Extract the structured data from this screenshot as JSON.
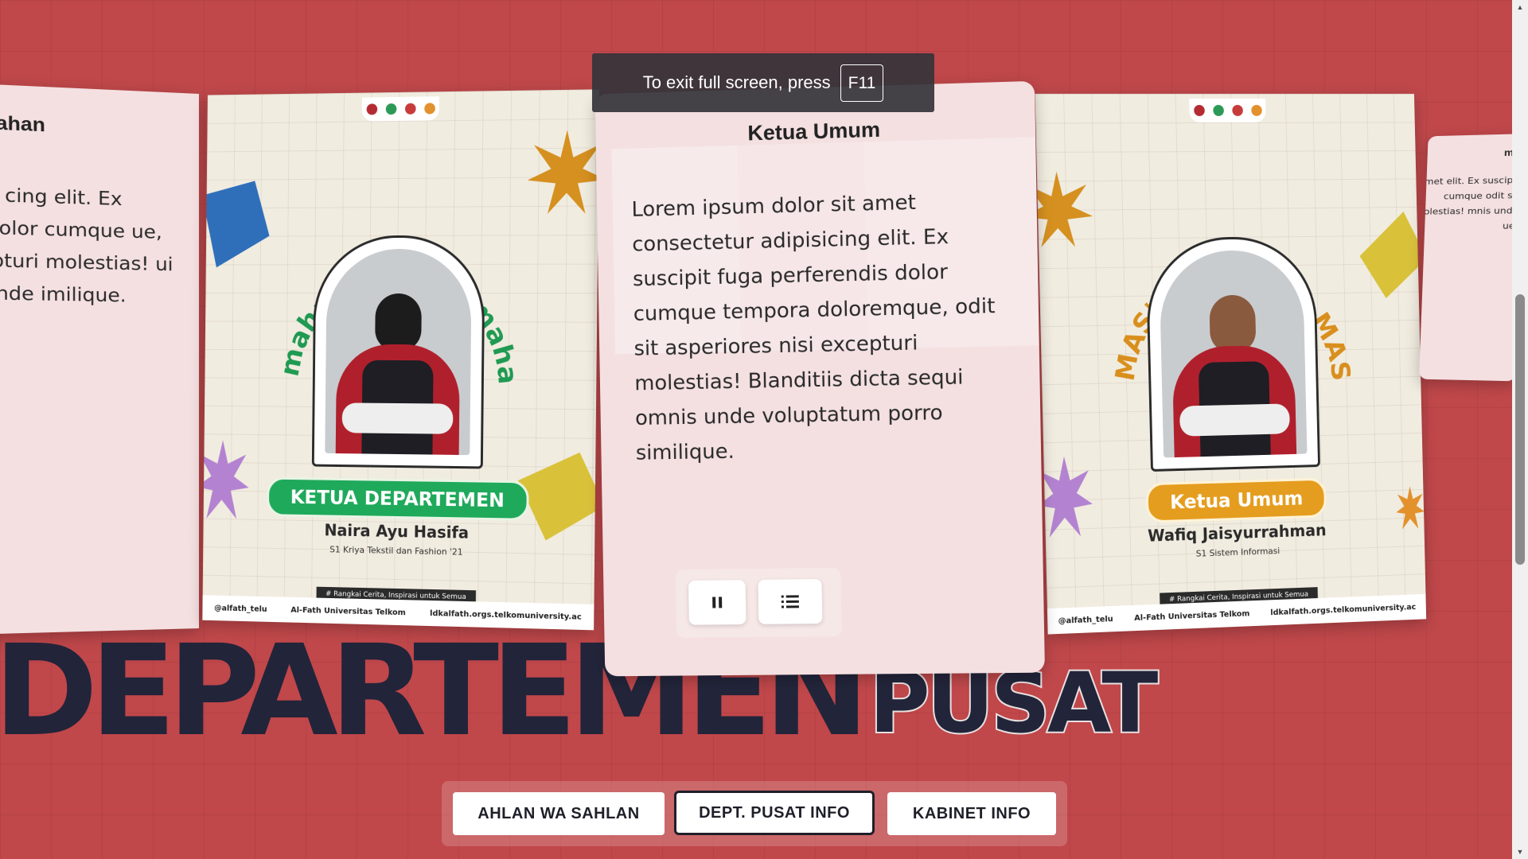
{
  "colors": {
    "background": "#c0474a",
    "heading": "#22243a",
    "card_pink": "#f4e0e1",
    "green_pill": "#1fa95b",
    "orange_pill": "#e59d1f"
  },
  "slides": {
    "far_left": {
      "title": "mahan",
      "text": "sit amet cing elit. Ex suscipit olor cumque ue, odit sit pturi molestias! ui omnis unde imilique."
    },
    "poster_left": {
      "arc_text": "mahan Kemuslimahan Kemusl",
      "role": "KETUA DEPARTEMEN",
      "name": "Naira Ayu Hasifa",
      "major": "S1 Kriya Tekstil dan Fashion '21",
      "tagline": "# Rangkai Cerita, Inspirasi untuk Semua",
      "footer": [
        "@alfath_telu",
        "Al-Fath Universitas Telkom",
        "ldkalfath.orgs.telkomuniversity.ac"
      ]
    },
    "center": {
      "title": "Ketua Umum",
      "text": "Lorem ipsum dolor sit amet consectetur adipisicing elit. Ex suscipit fuga perferendis dolor cumque tempora doloremque, odit sit asperiores nisi excepturi molestias! Blanditiis dicta sequi omnis unde voluptatum porro similique."
    },
    "poster_right": {
      "arc_text": "MAS'UL MAS'UL MAS'UL MASUL",
      "role": "Ketua Umum",
      "name": "Wafiq Jaisyurrahman",
      "major": "S1 Sistem Informasi",
      "tagline": "# Rangkai Cerita, Inspirasi untuk Semua",
      "footer": [
        "@alfath_telu",
        "Al-Fath Universitas Telkom",
        "ldkalfath.orgs.telkomuniversity.ac"
      ]
    },
    "far_right": {
      "title": "mum",
      "text": "amet elit. Ex suscipit cumque odit sit molestias! mnis unde ue."
    }
  },
  "controls": {
    "pause_icon": "pause-icon",
    "list_icon": "list-icon"
  },
  "heading": {
    "main": "DEPARTEMEN",
    "sub": "PUSAT"
  },
  "nav": {
    "ahlan": "AHLAN WA SAHLAN",
    "dept": "DEPT. PUSAT INFO",
    "kabinet": "KABINET INFO"
  },
  "toast": {
    "message": "To exit full screen, press",
    "key": "F11"
  }
}
